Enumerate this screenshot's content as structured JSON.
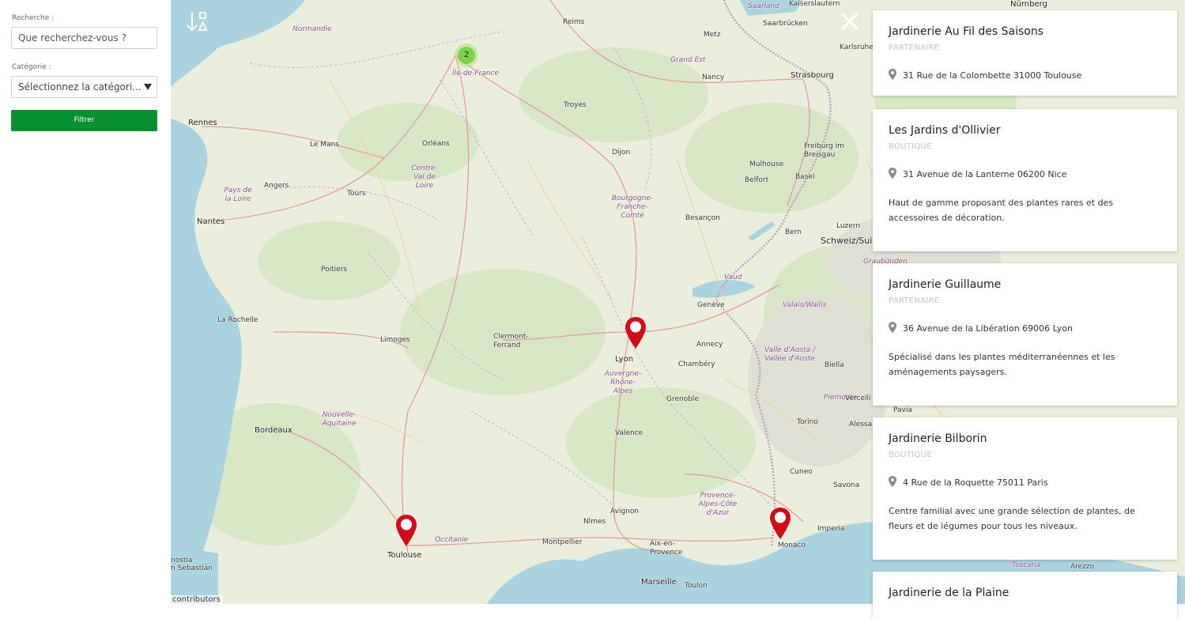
{
  "sidebar": {
    "search_label": "Recherche :",
    "search_placeholder": "Que recherchez-vous ?",
    "category_label": "Catégorie :",
    "category_selected": "Sélectionnez la catégori...",
    "filter_button": "Filtrer"
  },
  "map": {
    "cluster_count": "2",
    "attribution": "contributors",
    "places": [
      "Rennes",
      "Le Mans",
      "Orléans",
      "Angers",
      "Tours",
      "Nantes",
      "Poitiers",
      "La Rochelle",
      "Limoges",
      "Clermont-Ferrand",
      "Bordeaux",
      "Toulouse",
      "Montpellier",
      "Nîmes",
      "Avignon",
      "Aix-en-Provence",
      "Marseille",
      "Toulon",
      "Lyon",
      "Valence",
      "Grenoble",
      "Chambéry",
      "Annecy",
      "Genève",
      "Besançon",
      "Dijon",
      "Troyes",
      "Reims",
      "Metz",
      "Nancy",
      "Strasbourg",
      "Mulhouse",
      "Belfort",
      "Basel",
      "Freiburg im Breisgau",
      "Bern",
      "Luzern",
      "Torino",
      "Cuneo",
      "Savona",
      "Monaco",
      "Imperia",
      "Biella",
      "Vercelli",
      "Alessan",
      "Pavia",
      "Saarbrücken",
      "Kaiserslautern",
      "Karlsruhe",
      "Nürnberg",
      "Toscana",
      "Arezzo",
      "nostia",
      "n Sebastián"
    ],
    "regions": [
      "Normandie",
      "Île-de-France",
      "Grand Est",
      "Centre-Val de Loire",
      "Pays de la Loire",
      "Bourgogne-Franche-Comté",
      "Nouvelle-Aquitaine",
      "Auvergne-Rhône-Alpes",
      "Occitanie",
      "Provence-Alpes-Côte d'Azur",
      "Vaud",
      "Valais/Wallis",
      "Valle d'Aosta / Vallée d'Aoste",
      "Piemonte",
      "Schweiz/Suisse/Svizzera/Svizra",
      "Graubünden",
      "Saarland"
    ]
  },
  "results": [
    {
      "name": "Jardinerie Au Fil des Saisons",
      "type": "PARTENAIRE",
      "address": "31 Rue de la Colombette 31000 Toulouse",
      "description": ""
    },
    {
      "name": "Les Jardins d'Ollivier",
      "type": "BOUTIQUE",
      "address": "31 Avenue de la Lanterne 06200 Nice",
      "description": "Haut de gamme proposant des plantes rares et des accessoires de décoration."
    },
    {
      "name": "Jardinerie Guillaume",
      "type": "PARTENAIRE",
      "address": "36 Avenue de la Libération 69006 Lyon",
      "description": "Spécialisé dans les plantes méditerranéennes et les aménagements paysagers."
    },
    {
      "name": "Jardinerie Bilborin",
      "type": "BOUTIQUE",
      "address": "4 Rue de la Roquette 75011 Paris",
      "description": "Centre familial avec une grande sélection de plantes, de fleurs et de légumes pour tous les niveaux."
    },
    {
      "name": "Jardinerie de la Plaine",
      "type": "",
      "address": "",
      "description": ""
    }
  ],
  "colors": {
    "accent": "#079031",
    "marker": "#cc0d1d",
    "cluster": "#6ecc39"
  },
  "icons": {
    "sort": "sort-icon",
    "close": "close-icon",
    "marker": "map-marker-icon",
    "location": "location-pin-icon"
  }
}
